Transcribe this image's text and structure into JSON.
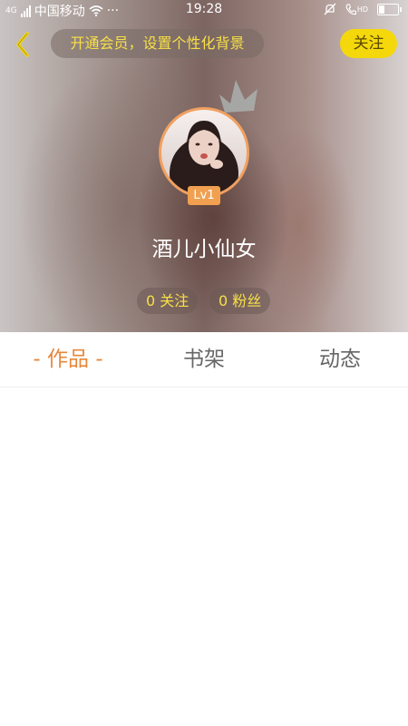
{
  "status_bar": {
    "carrier": "中国移动",
    "network": "4G",
    "more": "···",
    "time": "19:28",
    "hd": "HD"
  },
  "header": {
    "vip_banner": "开通会员，设置个性化背景",
    "follow_label": "关注",
    "level": "Lv1",
    "username": "酒儿小仙女",
    "following": "0 关注",
    "followers": "0 粉丝"
  },
  "tabs": [
    {
      "label": "作品",
      "active": true,
      "prefix": "-",
      "suffix": "-"
    },
    {
      "label": "书架",
      "active": false
    },
    {
      "label": "动态",
      "active": false
    }
  ],
  "colors": {
    "accent": "#e8873a",
    "follow_button": "#f5d80c",
    "banner_text": "#f7e047"
  }
}
